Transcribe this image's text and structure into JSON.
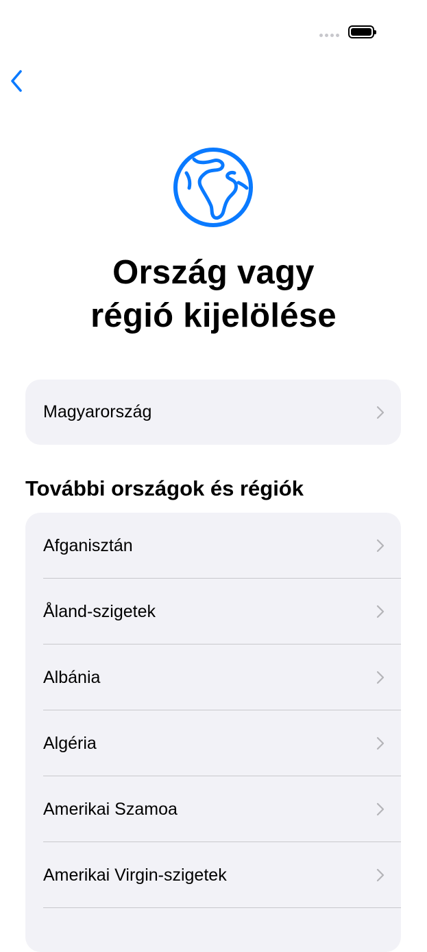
{
  "status_bar": {
    "signal_icon": "cellular-dots-icon",
    "battery_icon": "battery-full-icon"
  },
  "nav": {
    "back_icon": "chevron-left-icon",
    "accent_color": "#0a7aff"
  },
  "header": {
    "icon": "globe-icon",
    "title_line1": "Ország vagy",
    "title_line2": "régió kijelölése"
  },
  "current_region": {
    "label": "Magyarország"
  },
  "other_regions": {
    "header": "További országok és régiók",
    "items": [
      {
        "label": "Afganisztán"
      },
      {
        "label": "Åland-szigetek"
      },
      {
        "label": "Albánia"
      },
      {
        "label": "Algéria"
      },
      {
        "label": "Amerikai Szamoa"
      },
      {
        "label": "Amerikai Virgin-szigetek"
      },
      {
        "label": ""
      }
    ]
  }
}
